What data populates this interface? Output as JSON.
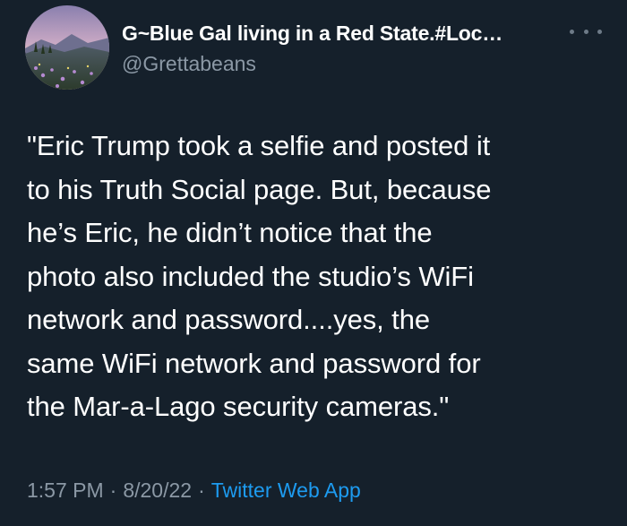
{
  "tweet": {
    "author": {
      "display_name": "G~Blue Gal living in a Red State.#Loc…",
      "handle": "@Grettabeans",
      "avatar_icon": "mountain-meadow-photo"
    },
    "more_icon": "ellipsis-icon",
    "text": "\"Eric Trump took a selfie and posted it\nto his Truth Social page. But, because\nhe’s Eric, he didn’t notice that the\nphoto also included the studio’s WiFi\nnetwork and password....yes, the\nsame WiFi network and password for\nthe Mar-a-Lago security cameras.\"",
    "time": "1:57 PM",
    "date": "8/20/22",
    "separator": "·",
    "source": "Twitter Web App"
  },
  "colors": {
    "background": "#15202b",
    "primary_text": "#ffffff",
    "secondary_text": "#8b98a5",
    "link": "#1d9bf0"
  }
}
